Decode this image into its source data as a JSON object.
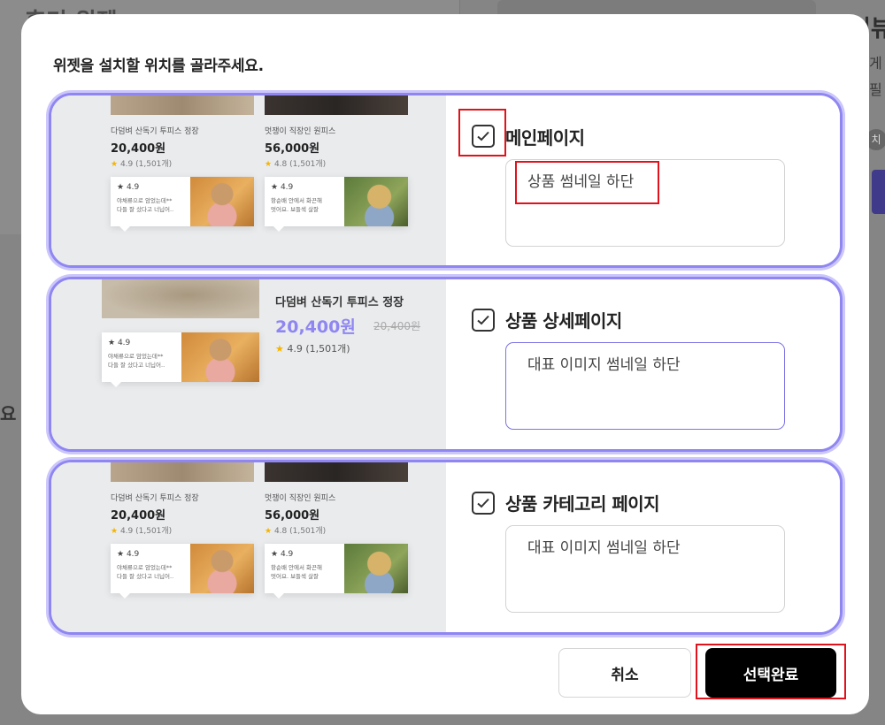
{
  "background": {
    "left_title": "후기 위젯",
    "right_title": "리뷰",
    "right_sub1": "게",
    "right_sub2": "필",
    "right_chip": "치",
    "left_question": "요"
  },
  "modal": {
    "title": "위젯을 설치할 위치를 골라주세요.",
    "options": [
      {
        "label": "메인페이지",
        "checked": true,
        "textarea": "상품 썸네일 하단"
      },
      {
        "label": "상품 상세페이지",
        "checked": true,
        "textarea": "대표 이미지 썸네일 하단"
      },
      {
        "label": "상품 카테고리 페이지",
        "checked": true,
        "textarea": "대표 이미지 썸네일 하단"
      }
    ],
    "cancel_label": "취소",
    "confirm_label": "선택완료"
  },
  "preview": {
    "product_a": {
      "name": "다덤벼 산독기 투피스 정장",
      "price": "20,400원",
      "rating": "4.9 (1,501개)"
    },
    "product_b": {
      "name": "멋쟁이 직장인 원피스",
      "price": "56,000원",
      "rating": "4.8 (1,501개)"
    },
    "review_a": {
      "score": "4.9",
      "line1": "야채류으로 암었는데**",
      "line2": "다들 잘 샀다고 너닙어.."
    },
    "review_b": {
      "score": "4.9",
      "line1": "항순배 안에서 화끈해",
      "line2": "멋어요. 보들섹 살잘"
    },
    "detail": {
      "name": "다덤벼 산독기 투피스 정장",
      "price": "20,400원",
      "old_price": "20,400원",
      "rating": "4.9 (1,501개)"
    },
    "star": "★"
  },
  "colors": {
    "accent": "#8f86f2",
    "highlight": "#e1121b",
    "confirm_bg": "#000000"
  }
}
